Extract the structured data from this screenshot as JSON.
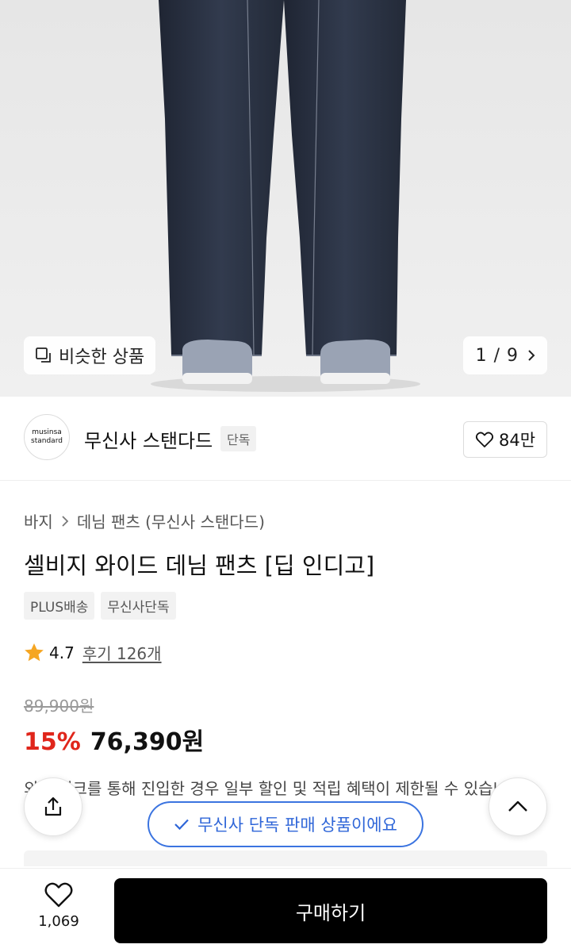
{
  "hero": {
    "similar_label": "비슷한 상품",
    "counter": "1 / 9"
  },
  "brand": {
    "logo_line1": "musinsa",
    "logo_line2": "standard",
    "name": "무신사 스탠다드",
    "tag": "단독",
    "likes": "84만"
  },
  "product": {
    "breadcrumb": [
      "바지",
      "데님 팬츠 (무신사 스탠다드)"
    ],
    "title": "셀비지 와이드 데님 팬츠 [딥 인디고]",
    "badges": [
      "PLUS배송",
      "무신사단독"
    ],
    "rating": "4.7",
    "reviews": "후기 126개",
    "original_price": "89,900원",
    "discount": "15%",
    "price": "76,390원",
    "notice": "외부 링크를 통해 진입한 경우 일부 할인 및 적립 혜택이 제한될 수 있습니다."
  },
  "floating": {
    "exclusive_label": "무신사 단독 판매 상품이에요"
  },
  "bottom": {
    "wish_count": "1,069",
    "buy_label": "구매하기"
  },
  "colors": {
    "discount_red": "#e0261b",
    "accent_blue": "#2f66d8",
    "denim": "#2a3140",
    "buy_button": "#000000"
  }
}
